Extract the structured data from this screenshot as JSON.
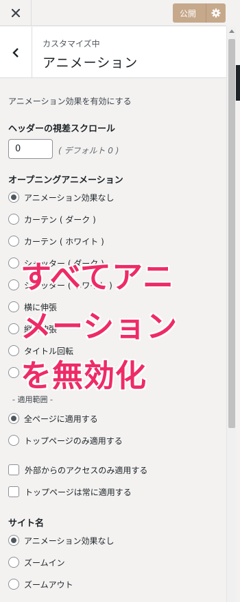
{
  "topbar": {
    "close_icon": "close-icon",
    "publish_label": "公開",
    "gear_icon": "gear-icon",
    "publish_color": "#c6a88b"
  },
  "header": {
    "breadcrumb": "カスタマイズ中",
    "title": "アニメーション",
    "back_icon": "chevron-left-icon"
  },
  "content": {
    "enable_text": "アニメーション効果を有効にする",
    "header_parallax": {
      "title": "ヘッダーの視差スクロール",
      "value": "0",
      "default_note": "( デフォルト 0 )"
    },
    "opening_animation": {
      "title": "オープニングアニメーション",
      "options": [
        {
          "label": "アニメーション効果なし",
          "checked": true
        },
        {
          "label": "カーテン ( ダーク )",
          "checked": false
        },
        {
          "label": "カーテン ( ホワイト )",
          "checked": false
        },
        {
          "label": "シャッター ( ダーク )",
          "checked": false
        },
        {
          "label": "シャッター ( ホワイト )",
          "checked": false
        },
        {
          "label": "横に伸張",
          "checked": false
        },
        {
          "label": "縦に伸張",
          "checked": false
        },
        {
          "label": "タイトル回転",
          "checked": false
        },
        {
          "label": "",
          "checked": false
        }
      ],
      "scope_label": "- 適用範囲 -",
      "scope_options": [
        {
          "label": "全ページに適用する",
          "checked": true
        },
        {
          "label": "トップページのみ適用する",
          "checked": false
        }
      ],
      "checkboxes": [
        {
          "label": "外部からのアクセスのみ適用する",
          "checked": false
        },
        {
          "label": "トップページは常に適用する",
          "checked": false
        }
      ]
    },
    "site_name": {
      "title": "サイト名",
      "options": [
        {
          "label": "アニメーション効果なし",
          "checked": true
        },
        {
          "label": "ズームイン",
          "checked": false
        },
        {
          "label": "ズームアウト",
          "checked": false
        }
      ]
    }
  },
  "overlay": {
    "line1": "すべてアニ",
    "line2": "メーション",
    "line3": "を無効化",
    "color": "#ee2b66"
  }
}
